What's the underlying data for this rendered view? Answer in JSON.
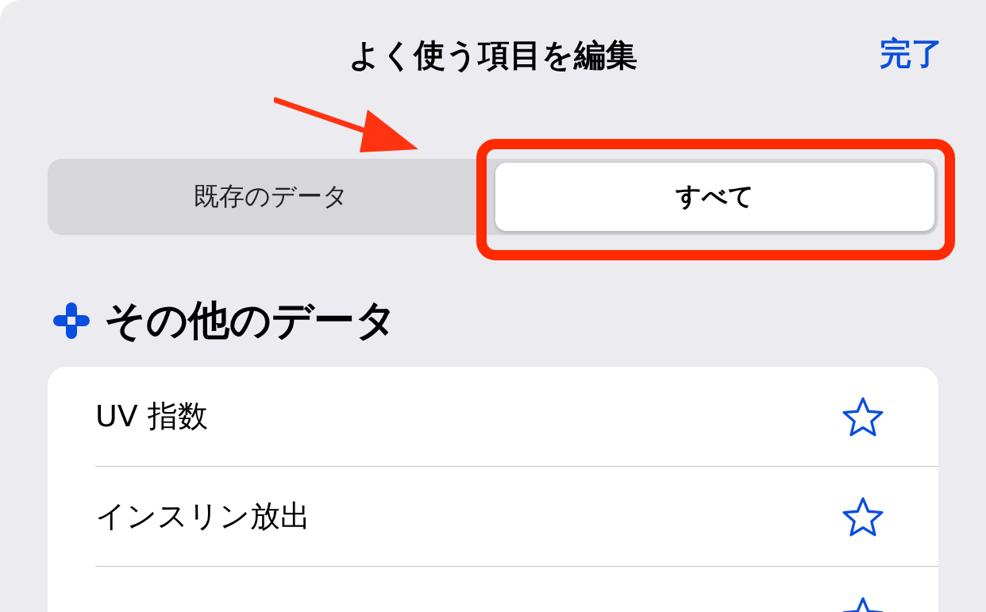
{
  "header": {
    "title": "よく使う項目を編集",
    "done": "完了"
  },
  "segments": [
    {
      "label": "既存のデータ",
      "selected": false
    },
    {
      "label": "すべて",
      "selected": true
    }
  ],
  "section": {
    "title": "その他のデータ"
  },
  "items": [
    {
      "label": "UV 指数",
      "favorite": false
    },
    {
      "label": "インスリン放出",
      "favorite": false
    },
    {
      "favorite": false
    }
  ],
  "annotations": {
    "arrow": true,
    "highlight": true
  }
}
